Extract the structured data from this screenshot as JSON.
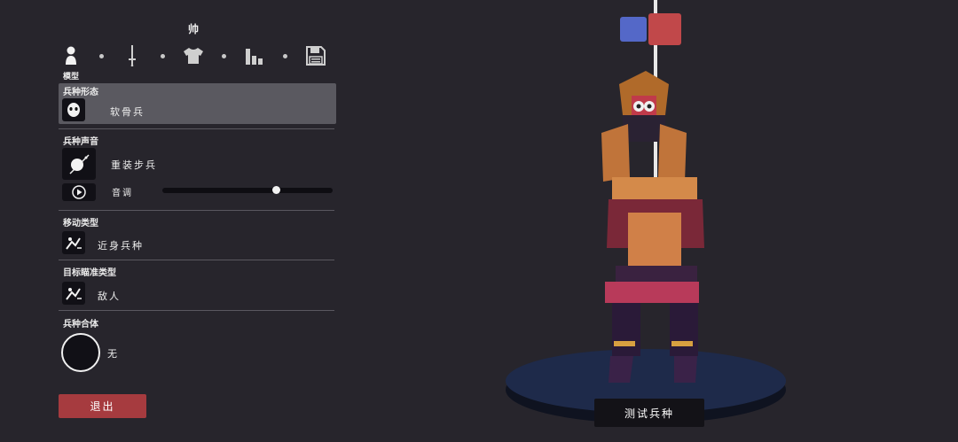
{
  "header": {
    "title": "帅"
  },
  "tabs": [
    {
      "icon": "unit-model-icon",
      "label": "模型",
      "active": true
    },
    {
      "icon": "sword-icon"
    },
    {
      "icon": "shirt-icon"
    },
    {
      "icon": "stats-bars-icon"
    },
    {
      "icon": "save-icon"
    }
  ],
  "sections": {
    "form": {
      "title": "兵种形态",
      "value": "软骨兵"
    },
    "voice": {
      "title": "兵种声音",
      "value": "重装步兵",
      "pitch_label": "音调",
      "pitch_level": 0.67
    },
    "movement": {
      "title": "移动类型",
      "value": "近身兵种"
    },
    "targeting": {
      "title": "目标瞄准类型",
      "value": "敌人"
    },
    "merge": {
      "title": "兵种合体",
      "value": "无"
    }
  },
  "buttons": {
    "exit": "退出",
    "test_unit": "测试兵种"
  },
  "colors": {
    "team_blue": "#5468c8",
    "team_red": "#c1484a",
    "exit_button": "#a63b3f",
    "background": "#27252c"
  }
}
